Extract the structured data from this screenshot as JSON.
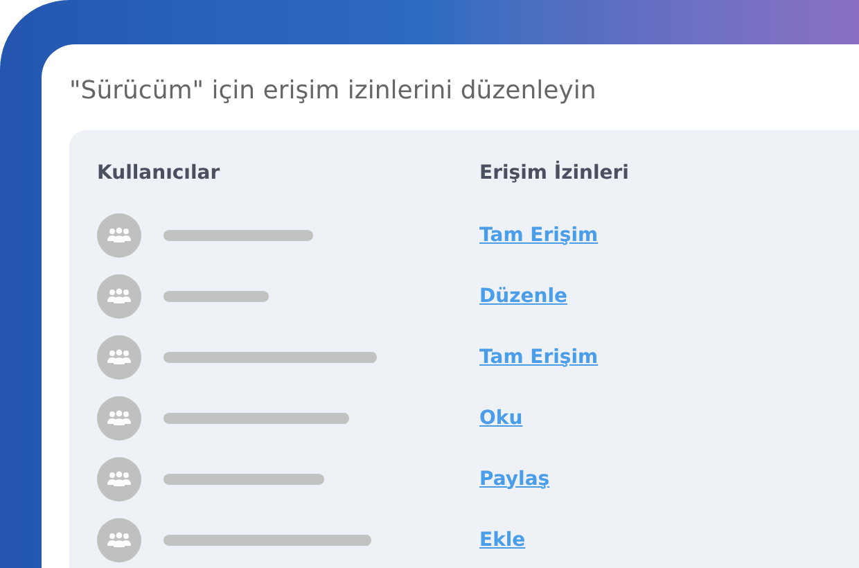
{
  "title": "\"Sürücüm\" için erişim izinlerini düzenleyin",
  "table": {
    "columns": [
      "Kullanıcılar",
      "Erişim İzinleri"
    ],
    "rows": [
      {
        "permission": "Tam Erişim"
      },
      {
        "permission": "Düzenle"
      },
      {
        "permission": "Tam Erişim"
      },
      {
        "permission": "Oku"
      },
      {
        "permission": "Paylaş"
      },
      {
        "permission": "Ekle"
      }
    ]
  }
}
